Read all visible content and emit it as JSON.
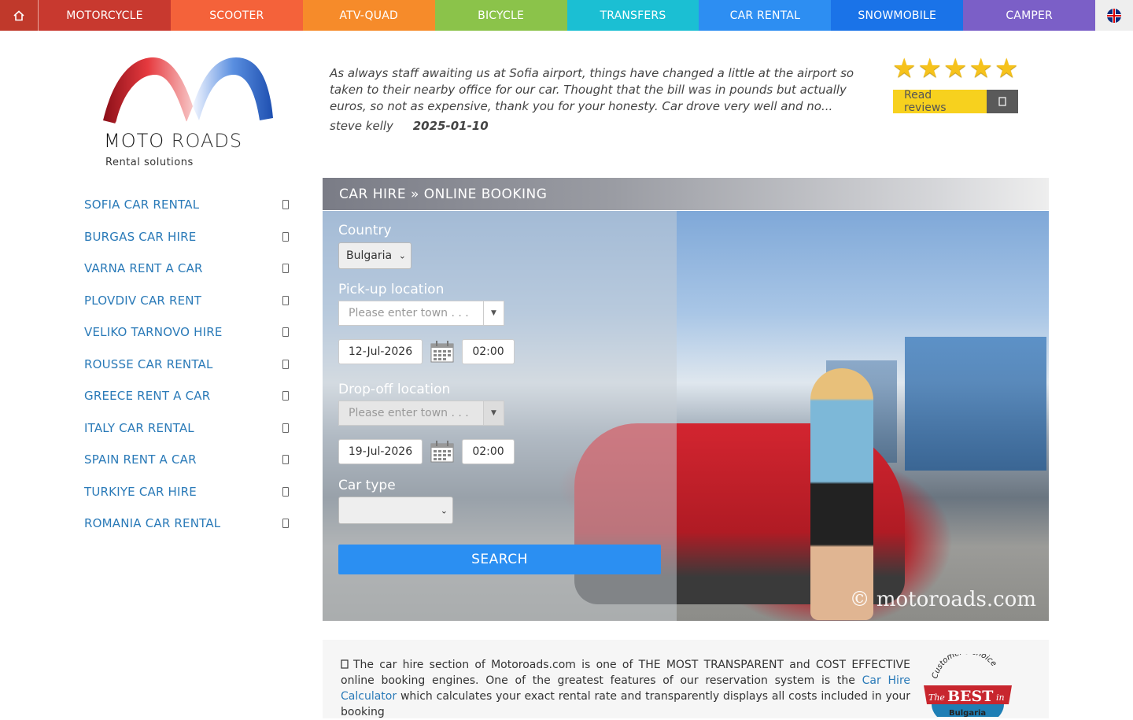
{
  "nav": {
    "home_icon": "home-icon",
    "items": [
      {
        "label": "MOTORCYCLE",
        "color": "#c8392f"
      },
      {
        "label": "SCOOTER",
        "color": "#f4623a"
      },
      {
        "label": "ATV-QUAD",
        "color": "#f68b2a"
      },
      {
        "label": "BICYCLE",
        "color": "#8bc34a"
      },
      {
        "label": "TRANSFERS",
        "color": "#1bbfd3"
      },
      {
        "label": "CAR RENTAL",
        "color": "#2d8ef2"
      },
      {
        "label": "SNOWMOBILE",
        "color": "#1a73e8"
      },
      {
        "label": "CAMPER",
        "color": "#7b5fc7"
      }
    ],
    "lang_icon": "uk-flag-icon"
  },
  "logo": {
    "brand_a": "MOTO",
    "brand_b": "ROADS",
    "tagline": "Rental solutions"
  },
  "review": {
    "text": "As always staff awaiting us at Sofia airport, things have changed a little at the airport so taken to their nearby office for our car. Thought that the bill was in pounds but actually euros, so not as expensive, thank you for your honesty. Car drove very well and no...",
    "author": "steve kelly",
    "date": "2025-01-10",
    "stars": 5,
    "read_label": "Read reviews"
  },
  "sidebar": {
    "items": [
      "SOFIA CAR RENTAL",
      "BURGAS CAR HIRE",
      "VARNA RENT A CAR",
      "PLOVDIV CAR RENT",
      "VELIKO TARNOVO HIRE",
      "ROUSSE CAR RENTAL",
      "GREECE RENT A CAR",
      "ITALY CAR RENTAL",
      "SPAIN RENT A CAR",
      "TURKIYE CAR HIRE",
      "ROMANIA CAR RENTAL"
    ]
  },
  "booking": {
    "title": "CAR HIRE » ONLINE BOOKING",
    "country_label": "Country",
    "country_value": "Bulgaria",
    "pickup_label": "Pick-up location",
    "pickup_placeholder": "Please enter town . . .",
    "pickup_date": "12-Jul-2026",
    "pickup_time": "02:00",
    "dropoff_label": "Drop-off location",
    "dropoff_placeholder": "Please enter town . . .",
    "dropoff_date": "19-Jul-2026",
    "dropoff_time": "02:00",
    "cartype_label": "Car type",
    "cartype_value": "",
    "search_label": "SEARCH",
    "watermark": "© motoroads.com"
  },
  "info": {
    "text_before": "The car hire section of Motoroads.com is one of THE MOST TRANSPARENT and COST EFFECTIVE online booking engines. One of the greatest features of our reservation system is the ",
    "link": "Car Hire Calculator",
    "text_after": " which calculates your exact rental rate and transparently displays all costs included in your booking",
    "badge_top": "Customer's choice",
    "badge_mid_a": "The",
    "badge_mid_b": "BEST",
    "badge_mid_c": "in",
    "badge_bottom": "Bulgaria"
  }
}
